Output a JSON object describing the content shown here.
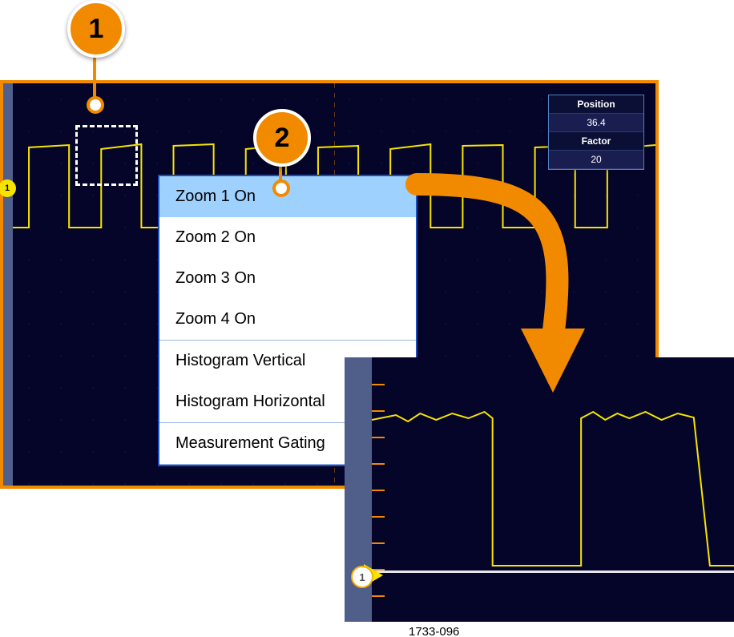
{
  "readout": {
    "position_label": "Position",
    "position_value": "36.4",
    "factor_label": "Factor",
    "factor_value": "20"
  },
  "context_menu": {
    "groups": [
      {
        "items": [
          {
            "label": "Zoom 1 On",
            "selected": true
          },
          {
            "label": "Zoom 2 On"
          },
          {
            "label": "Zoom 3 On"
          },
          {
            "label": "Zoom 4 On"
          }
        ]
      },
      {
        "items": [
          {
            "label": "Histogram Vertical"
          },
          {
            "label": "Histogram Horizontal"
          }
        ]
      },
      {
        "items": [
          {
            "label": "Measurement Gating"
          }
        ]
      }
    ]
  },
  "callouts": {
    "c1": "1",
    "c2": "2"
  },
  "zoom_marker": "1",
  "channel_marker": "1",
  "image_id": "1733-096"
}
